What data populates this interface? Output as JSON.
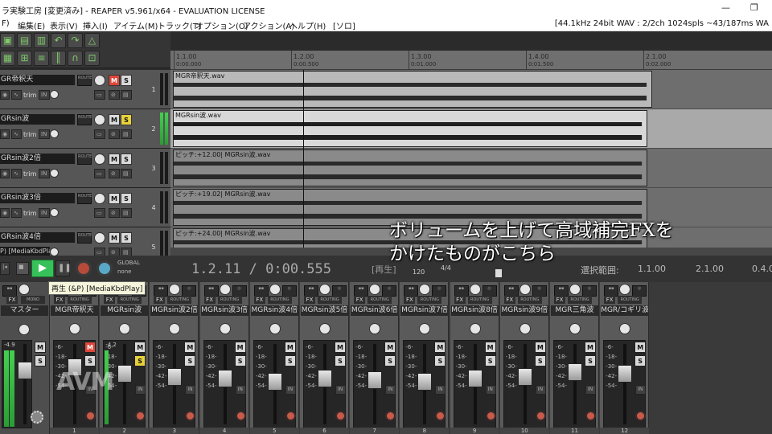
{
  "window": {
    "title": "ラ実験工房 [変更済み] - REAPER v5.961/x64 - EVALUATION LICENSE",
    "minimize": "—",
    "restore": "❐"
  },
  "menu": {
    "items": [
      "F)",
      "編集(E)",
      "表示(V)",
      "挿入(I)",
      "アイテム(M)",
      "トラック(T)",
      "オプション(O)",
      "アクション(A)",
      "ヘルプ(H)",
      "[ソロ]"
    ],
    "audio_info": "[44.1kHz 24bit WAV : 2/2ch 1024spls ~43/187ms WA"
  },
  "tracks": [
    {
      "name": "GR帝釈天",
      "number": "1",
      "mute_active": true,
      "solo_active": false,
      "meter": false,
      "item_label": "MGR帝釈天.wav",
      "item_bg": "#b9b9b9"
    },
    {
      "name": "GRsin波",
      "number": "2",
      "mute_active": false,
      "solo_active": true,
      "meter": true,
      "item_label": "MGRsin波.wav",
      "item_bg": "#d8d8d8"
    },
    {
      "name": "GRsin波2倍",
      "number": "3",
      "mute_active": false,
      "solo_active": false,
      "meter": false,
      "item_label": "ピッチ:+12.00| MGRsin波.wav",
      "item_bg": "#8a8a8a"
    },
    {
      "name": "GRsin波3倍",
      "number": "4",
      "mute_active": false,
      "solo_active": false,
      "meter": false,
      "item_label": "ピッチ:+19.02| MGRsin波.wav",
      "item_bg": "#8a8a8a"
    },
    {
      "name": "GRsin波4倍",
      "number": "5",
      "mute_active": false,
      "solo_active": false,
      "meter": false,
      "item_label": "ピッチ:+24.00| MGRsin波.wav",
      "item_bg": "#8a8a8a"
    }
  ],
  "tcp_labels": {
    "route": "ROUTE",
    "trim": "trim",
    "in": "IN",
    "mute": "M",
    "solo": "S"
  },
  "ruler": {
    "marks": [
      {
        "label": "1.1.00",
        "sub": "0:00.000"
      },
      {
        "label": "1.2.00",
        "sub": "0:00.500"
      },
      {
        "label": "1.3.00",
        "sub": "0:01.000"
      },
      {
        "label": "1.4.00",
        "sub": "0:01.500"
      },
      {
        "label": "2.1.00",
        "sub": "0:02.000"
      }
    ]
  },
  "transport": {
    "position": "1.2.11 / 0:00.555",
    "state": "[再生]",
    "tempo": "120",
    "timesig": "4/4",
    "selection_label": "選択範囲:",
    "sel_start": "1.1.00",
    "sel_end": "2.1.00",
    "sel_len": "0.4.0",
    "global": "GLOBAL",
    "auto_mode": "none"
  },
  "tooltip": "再生 (&P) [MediaKbdPlay]",
  "tooltip_behind": "P) [MediaKbdPlay]",
  "mixer": {
    "master": {
      "name": "マスター",
      "mono": "MONO",
      "db": "-4.9"
    },
    "strips": [
      {
        "name": "MGR帝釈天",
        "number": "1",
        "mute_active": true,
        "solo_active": false,
        "meter": false
      },
      {
        "name": "MGRsin波",
        "number": "2",
        "mute_active": false,
        "solo_active": true,
        "meter": true
      },
      {
        "name": "MGRsin波2倍",
        "number": "3",
        "mute_active": false,
        "solo_active": false,
        "meter": false
      },
      {
        "name": "MGRsin波3倍",
        "number": "4",
        "mute_active": false,
        "solo_active": false,
        "meter": false
      },
      {
        "name": "MGRsin波4倍",
        "number": "5",
        "mute_active": false,
        "solo_active": false,
        "meter": false
      },
      {
        "name": "MGRsin波5倍",
        "number": "6",
        "mute_active": false,
        "solo_active": false,
        "meter": false
      },
      {
        "name": "MGRsin波6倍",
        "number": "7",
        "mute_active": false,
        "solo_active": false,
        "meter": false
      },
      {
        "name": "MGRsin波7倍",
        "number": "8",
        "mute_active": false,
        "solo_active": false,
        "meter": false
      },
      {
        "name": "MGRsin波8倍",
        "number": "9",
        "mute_active": false,
        "solo_active": false,
        "meter": false
      },
      {
        "name": "MGRsin波9倍",
        "number": "10",
        "mute_active": false,
        "solo_active": false,
        "meter": false
      },
      {
        "name": "MGR三角波",
        "number": "11",
        "mute_active": false,
        "solo_active": false,
        "meter": false
      },
      {
        "name": "MGR/コギリ波",
        "number": "12",
        "mute_active": false,
        "solo_active": false,
        "meter": false
      }
    ],
    "fx": "FX",
    "routing": "ROUTING",
    "scale": [
      "-6-",
      "-18-",
      "-30-",
      "-42-",
      "-54-"
    ],
    "peak_2": "-4.2",
    "mute": "M",
    "solo": "S",
    "in": "IN"
  },
  "caption": {
    "line1": "ボリュームを上げて高域補完FXを",
    "line2": "かけたものがこちら"
  },
  "watermark": "AVM",
  "colors": {
    "mute_red": "#e0463a",
    "solo_yellow": "#e8d23a",
    "meter_green": "#44d050",
    "play_green": "#37c15a"
  }
}
